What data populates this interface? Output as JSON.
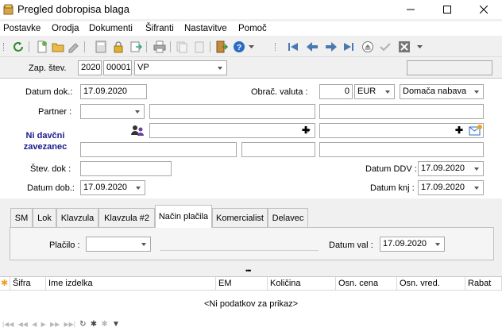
{
  "window": {
    "title": "Pregled dobropisa blaga"
  },
  "menu": [
    "Postavke",
    "Orodja",
    "Dokumenti",
    "Šifranti",
    "Nastavitve",
    "Pomoč"
  ],
  "header": {
    "zap_label": "Zap. štev.",
    "year": "2020",
    "number": "00001",
    "doc_type": "VP"
  },
  "form": {
    "datum_dok_label": "Datum dok.:",
    "datum_dok": "17.09.2020",
    "obrac_valuta_label": "Obrač. valuta :",
    "valuta_amount": "0",
    "valuta": "EUR",
    "nabava": "Domača nabava",
    "partner_label": "Partner :",
    "ni_davcni": "Ni davčni zavezanec",
    "stev_dok_label": "Štev. dok :",
    "datum_ddv_label": "Datum DDV :",
    "datum_ddv": "17.09.2020",
    "datum_dob_label": "Datum dob.:",
    "datum_dob": "17.09.2020",
    "datum_knj_label": "Datum knj :",
    "datum_knj": "17.09.2020"
  },
  "tabs": [
    "SM",
    "Lok",
    "Klavzula",
    "Klavzula #2",
    "Način plačila",
    "Komercialist",
    "Delavec"
  ],
  "active_tab": "Način plačila",
  "payment": {
    "placilo_label": "Plačilo :",
    "datum_val_label": "Datum val :",
    "datum_val": "17.09.2020"
  },
  "grid": {
    "columns": [
      "Šifra",
      "Ime izdelka",
      "EM",
      "Količina",
      "Osn. cena",
      "Osn. vred.",
      "Rabat"
    ],
    "empty_text": "<Ni podatkov za prikaz>"
  },
  "colors": {
    "accent_link": "#1a1a8c"
  }
}
